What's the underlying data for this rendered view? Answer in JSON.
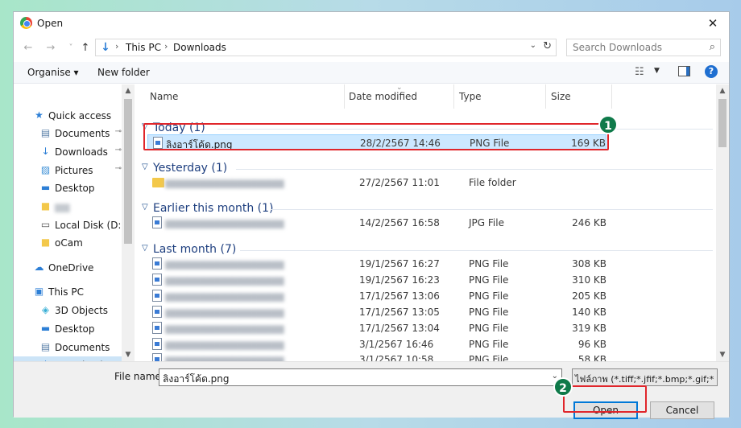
{
  "window": {
    "title": "Open",
    "close_glyph": "✕"
  },
  "nav_buttons": {
    "back": "←",
    "forward": "→",
    "recent": "˅",
    "up": "↑"
  },
  "address": {
    "crumbs": [
      "This PC",
      "Downloads"
    ],
    "sep": "›",
    "drop": "⌄",
    "refresh": "↻"
  },
  "search": {
    "placeholder": "Search Downloads",
    "icon": "⌕"
  },
  "toolbar": {
    "organise": "Organise ▾",
    "new_folder": "New folder",
    "view_drop": "▼",
    "help": "?"
  },
  "navpane": {
    "items": [
      {
        "label": "Quick access",
        "icon": "★",
        "color": "#2d7fd6"
      },
      {
        "label": "Documents",
        "icon": "▤",
        "color": "#5a7fa8",
        "pin": true
      },
      {
        "label": "Downloads",
        "icon": "↓",
        "color": "#2d7fd6",
        "pin": true
      },
      {
        "label": "Pictures",
        "icon": "▨",
        "color": "#3b8fd6",
        "pin": true
      },
      {
        "label": "Desktop",
        "icon": "▬",
        "color": "#2d7fd6"
      },
      {
        "label": "",
        "icon": "■",
        "color": "#f3c84a",
        "blur": true
      },
      {
        "label": "Local Disk (D:)",
        "icon": "▭",
        "color": "#555"
      },
      {
        "label": "oCam",
        "icon": "■",
        "color": "#f3c84a"
      },
      {
        "label": "OneDrive",
        "icon": "☁",
        "color": "#2d7fd6"
      },
      {
        "label": "This PC",
        "icon": "▣",
        "color": "#2d7fd6"
      },
      {
        "label": "3D Objects",
        "icon": "◈",
        "color": "#3bb0d6"
      },
      {
        "label": "Desktop",
        "icon": "▬",
        "color": "#2d7fd6"
      },
      {
        "label": "Documents",
        "icon": "▤",
        "color": "#5a7fa8"
      },
      {
        "label": "Downloads",
        "icon": "↓",
        "color": "#2d7fd6",
        "selected": true
      }
    ],
    "pin_glyph": "📌"
  },
  "columns": {
    "name": "Name",
    "date": "Date modified",
    "type": "Type",
    "size": "Size"
  },
  "groups": [
    {
      "label": "Today (1)"
    },
    {
      "label": "Yesterday (1)"
    },
    {
      "label": "Earlier this month (1)"
    },
    {
      "label": "Last month (7)"
    }
  ],
  "files": [
    {
      "name": "ลิงอาร์โค้ด.png",
      "date": "28/2/2567 14:46",
      "type": "PNG File",
      "size": "169 KB",
      "selected": true
    },
    {
      "name": "",
      "date": "27/2/2567 11:01",
      "type": "File folder",
      "size": "",
      "folder": true
    },
    {
      "name": "",
      "date": "14/2/2567 16:58",
      "type": "JPG File",
      "size": "246 KB"
    },
    {
      "name": "",
      "date": "19/1/2567 16:27",
      "type": "PNG File",
      "size": "308 KB"
    },
    {
      "name": "",
      "date": "19/1/2567 16:23",
      "type": "PNG File",
      "size": "310 KB"
    },
    {
      "name": "",
      "date": "17/1/2567 13:06",
      "type": "PNG File",
      "size": "205 KB"
    },
    {
      "name": "",
      "date": "17/1/2567 13:05",
      "type": "PNG File",
      "size": "140 KB"
    },
    {
      "name": "",
      "date": "17/1/2567 13:04",
      "type": "PNG File",
      "size": "319 KB"
    },
    {
      "name": "",
      "date": "3/1/2567 16:46",
      "type": "PNG File",
      "size": "96 KB"
    },
    {
      "name": "",
      "date": "3/1/2567 10:58",
      "type": "PNG File",
      "size": "58 KB"
    }
  ],
  "bottom": {
    "file_name_label": "File name:",
    "file_name_value": "ลิงอาร์โค้ด.png",
    "file_type": "ไฟล์ภาพ (*.tiff;*.jfif;*.bmp;*.gif;*",
    "open": "Open",
    "cancel": "Cancel",
    "drop": "⌄"
  },
  "annotations": {
    "badge1": "1",
    "badge2": "2",
    "color": "#e0262b"
  }
}
